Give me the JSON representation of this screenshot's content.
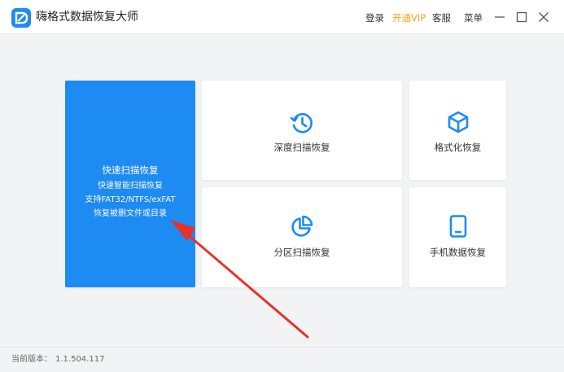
{
  "app": {
    "title": "嗨格式数据恢复大师",
    "brand_color": "#1e8bf2",
    "logo_icon": "d-logo-icon"
  },
  "header": {
    "login": "登录",
    "vip": "开通VIP",
    "service": "客服",
    "menu": "菜单",
    "minimize_icon": "minimize-icon",
    "maximize_icon": "maximize-icon",
    "close_icon": "close-icon"
  },
  "modes": {
    "quick": {
      "title": "快速扫描恢复",
      "lines": [
        "快速智能扫描恢复",
        "支持FAT32/NTFS/exFAT",
        "恢复被删文件或目录"
      ]
    },
    "deep": {
      "label": "深度扫描恢复",
      "icon": "history-icon"
    },
    "format": {
      "label": "格式化恢复",
      "icon": "cube-icon"
    },
    "partition": {
      "label": "分区扫描恢复",
      "icon": "pie-chart-icon"
    },
    "phone": {
      "label": "手机数据恢复",
      "icon": "tablet-icon"
    }
  },
  "annotation": {
    "color": "#e8312a"
  },
  "footer": {
    "version_label": "当前版本：",
    "version": "1.1.504.117"
  }
}
